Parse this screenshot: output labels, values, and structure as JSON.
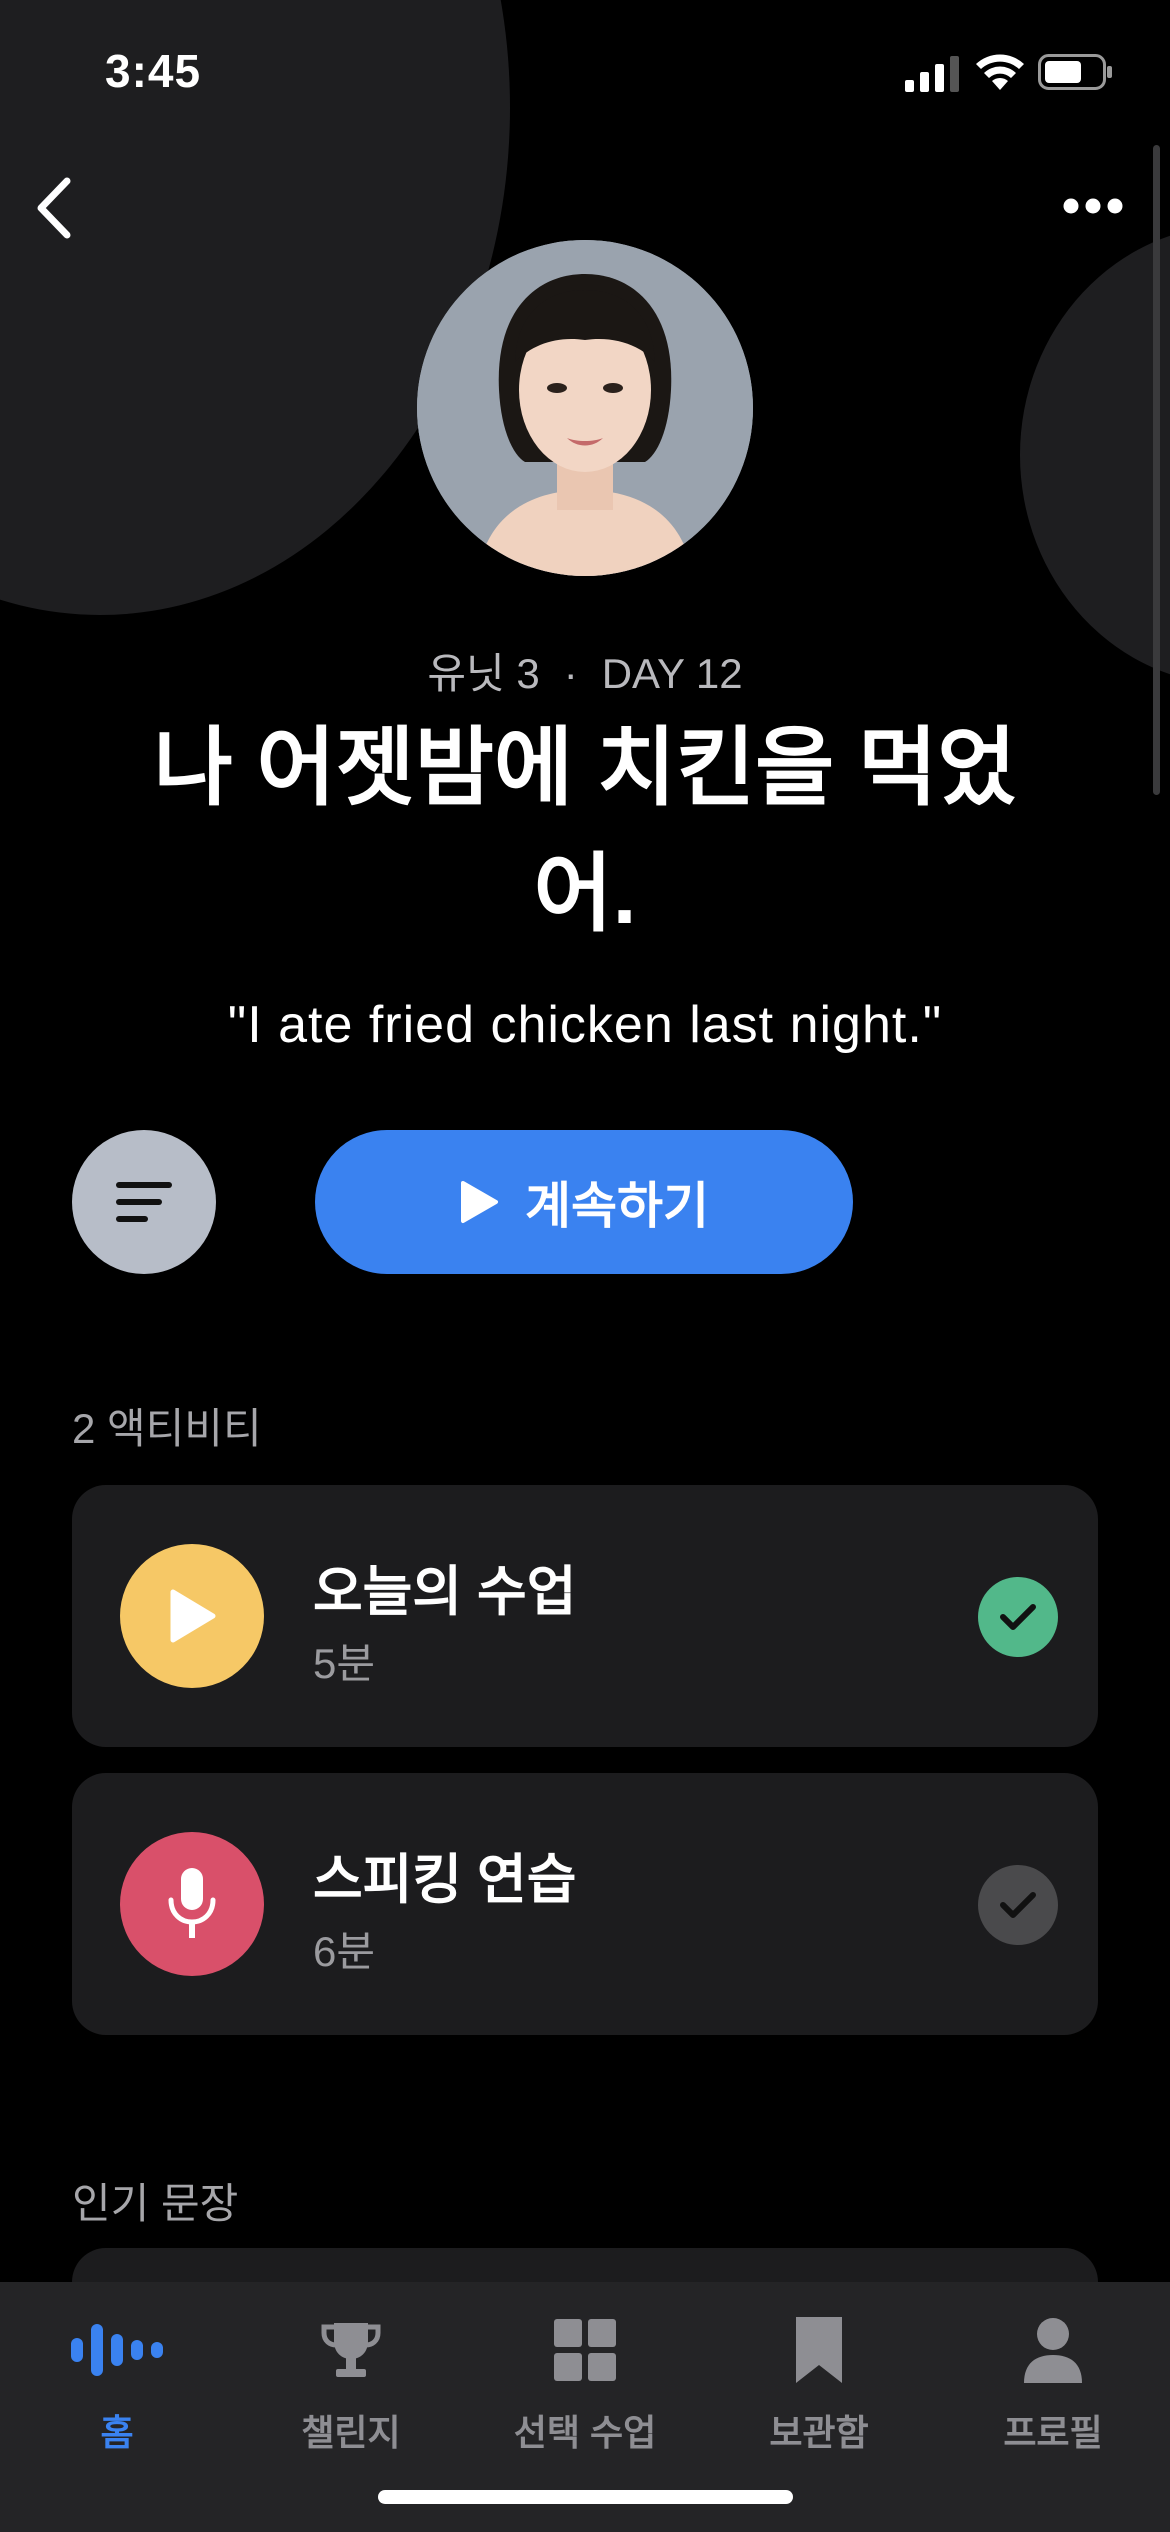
{
  "status_bar": {
    "time": "3:45"
  },
  "lesson": {
    "unit": "유닛 3",
    "separator": "·",
    "day": "DAY 12",
    "title": "나 어젯밤에 치킨을 먹었어.",
    "translation": "\"I ate fried chicken last night.\""
  },
  "actions": {
    "continue_label": "계속하기"
  },
  "activities": {
    "header": "2 액티비티",
    "items": [
      {
        "title": "오늘의 수업",
        "duration": "5분",
        "icon": "play-icon",
        "icon_color": "#f6c866",
        "completed": true
      },
      {
        "title": "스피킹 연습",
        "duration": "6분",
        "icon": "microphone-icon",
        "icon_color": "#d9506a",
        "completed": false
      }
    ]
  },
  "popular": {
    "header": "인기 문장"
  },
  "tab_bar": {
    "items": [
      {
        "label": "홈",
        "icon": "audio-wave-icon",
        "active": true
      },
      {
        "label": "챌린지",
        "icon": "trophy-icon",
        "active": false
      },
      {
        "label": "선택 수업",
        "icon": "grid-icon",
        "active": false
      },
      {
        "label": "보관함",
        "icon": "bookmark-icon",
        "active": false
      },
      {
        "label": "프로필",
        "icon": "person-icon",
        "active": false
      }
    ]
  },
  "colors": {
    "accent": "#3a82f0",
    "check_complete": "#52b88a",
    "check_incomplete": "#4a4a4c"
  }
}
